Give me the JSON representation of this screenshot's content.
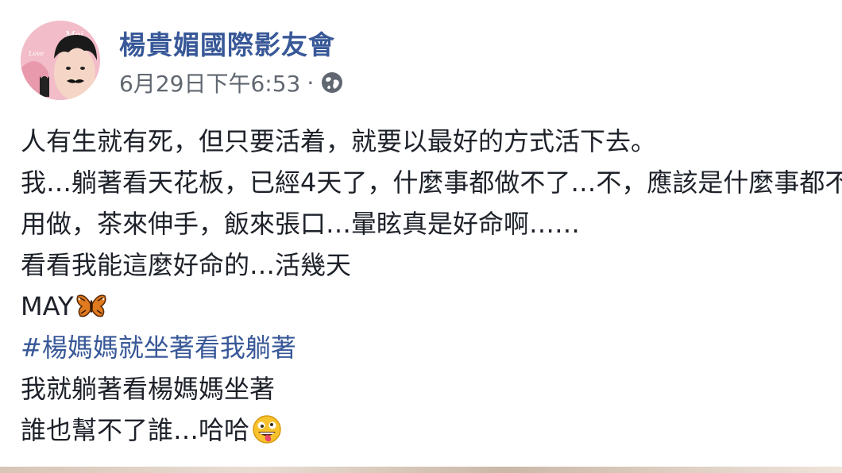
{
  "post": {
    "author": "楊貴媚國際影友會",
    "timestamp": "6月29日下午6:53",
    "separator": "·",
    "privacy_icon": "globe-icon",
    "avatar": "page-avatar",
    "lines": [
      "人有生就有死，但只要活着，就要以最好的方式活下去。",
      "我…躺著看天花板，已經4天了，什麼事都做不了…不，應該是什麼事都不",
      "用做，茶來伸手，飯來張口…暈眩真是好命啊……",
      "看看我能這麼好命的…活幾天"
    ],
    "signature": "MAY",
    "signature_emoji": "butterfly-icon",
    "hashtag": "#楊媽媽就坐著看我躺著",
    "line_after_hashtag": "我就躺著看楊媽媽坐著",
    "closing": "誰也幫不了誰…哈哈",
    "closing_emoji": "grinning-tongue-emoji-icon"
  },
  "colors": {
    "link": "#385898",
    "text": "#1d2129",
    "meta": "#606770"
  }
}
